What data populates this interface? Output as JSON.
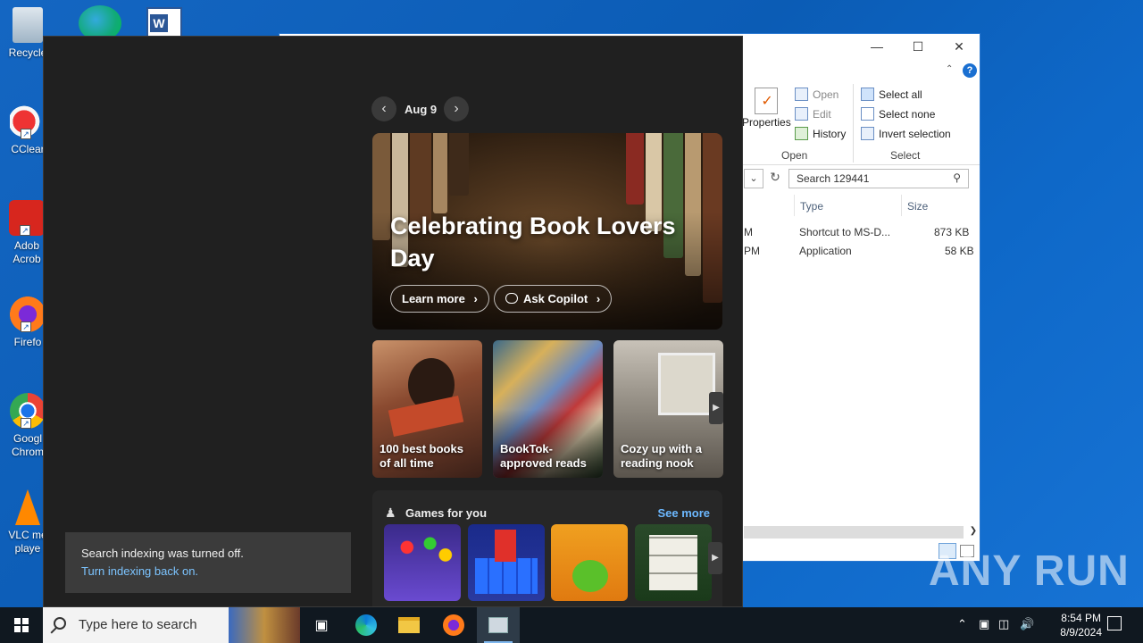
{
  "desktop": {
    "icons": [
      {
        "label": "Recycle",
        "icon": "recycle-bin-icon"
      },
      {
        "label": "CClear",
        "icon": "ccleaner-icon"
      },
      {
        "label": "Adob Acrob",
        "icon": "acrobat-icon"
      },
      {
        "label": "Firefo",
        "icon": "firefox-icon"
      },
      {
        "label": "Googl Chrom",
        "icon": "chrome-icon"
      },
      {
        "label": "VLC me playe",
        "icon": "vlc-icon"
      }
    ]
  },
  "explorer": {
    "ribbon": {
      "properties": "Properties",
      "open": "Open",
      "edit": "Edit",
      "history": "History",
      "select_all": "Select all",
      "select_none": "Select none",
      "invert_selection": "Invert selection",
      "group_open": "Open",
      "group_select": "Select"
    },
    "search_placeholder": "Search 129441",
    "columns": {
      "type": "Type",
      "size": "Size"
    },
    "rows": [
      {
        "date_frag": "M",
        "type": "Shortcut to MS-D...",
        "size": "873 KB"
      },
      {
        "date_frag": "PM",
        "type": "Application",
        "size": "58 KB"
      }
    ]
  },
  "widgets": {
    "date": "Aug 9",
    "hero": {
      "title": "Celebrating Book Lovers Day",
      "learn_more": "Learn more",
      "ask_copilot": "Ask Copilot"
    },
    "cards": [
      {
        "caption": "100 best books of all time"
      },
      {
        "caption": "BookTok-approved reads"
      },
      {
        "caption": "Cozy up with a reading nook"
      }
    ],
    "games": {
      "title": "Games for you",
      "see_more": "See more"
    },
    "toast": {
      "message": "Search indexing was turned off.",
      "link": "Turn indexing back on."
    }
  },
  "taskbar": {
    "search_placeholder": "Type here to search",
    "time": "8:54 PM",
    "date": "8/9/2024"
  },
  "watermark": "ANY RUN"
}
